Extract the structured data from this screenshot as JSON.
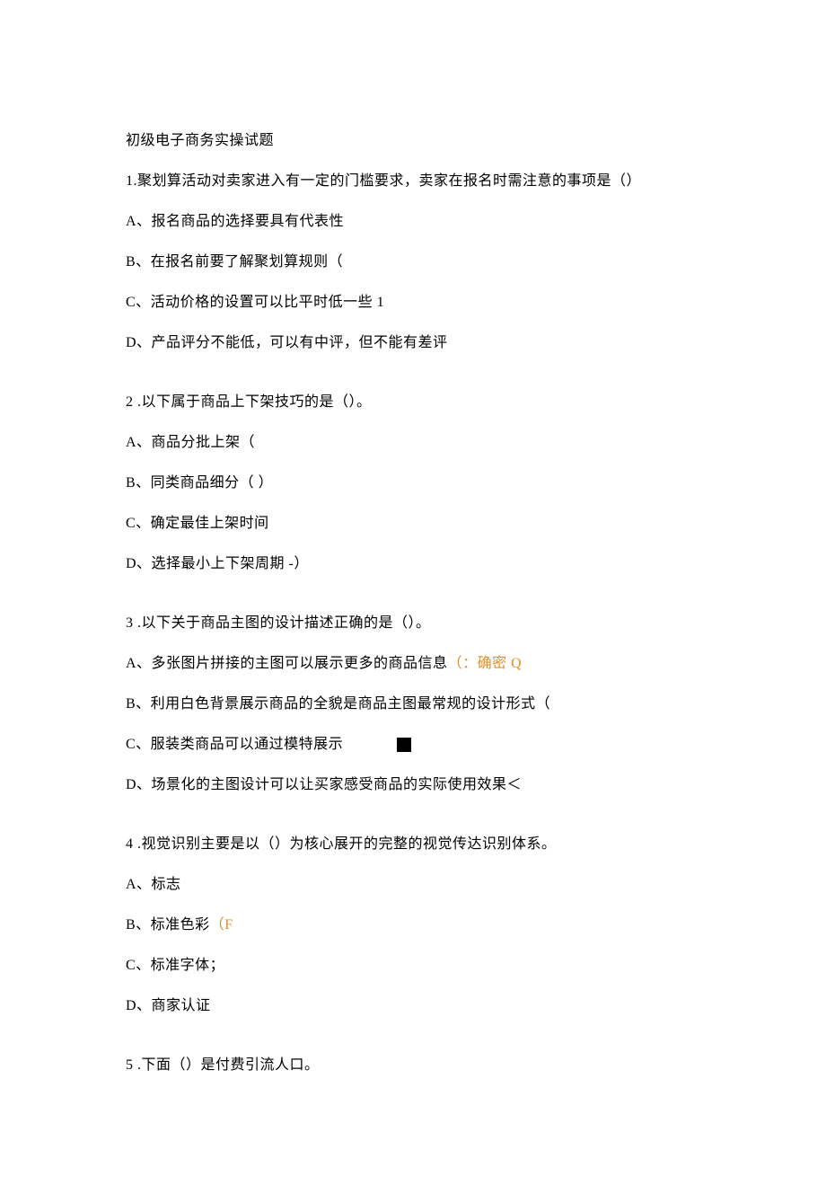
{
  "title": "初级电子商务实操试题",
  "q1": {
    "stem": "1.聚划算活动对卖家进入有一定的门槛要求，卖家在报名时需注意的事项是（）",
    "a": "A、报名商品的选择要具有代表性",
    "b": "B、在报名前要了解聚划算规则（",
    "c": "C、活动价格的设置可以比平时低一些 1",
    "d": "D、产品评分不能低，可以有中评，但不能有差评"
  },
  "q2": {
    "stem": "2  .以下属于商品上下架技巧的是（）。",
    "a": "A、商品分批上架（",
    "b": "B、同类商品细分（            ）",
    "c": "C、确定最佳上架时间",
    "d": "D、选择最小上下架周期             -）"
  },
  "q3": {
    "stem": "3  .以下关于商品主图的设计描述正确的是（）。",
    "a_pre": "A、多张图片拼接的主图可以展示更多的商品信息",
    "a_orange": "（：确密 Q",
    "b": "B、利用白色背景展示商品的全貌是商品主图最常规的设计形式（",
    "c": "C、服装类商品可以通过模特展示",
    "d": "D、场景化的主图设计可以让买家感受商品的实际使用效果＜"
  },
  "q4": {
    "stem": "4  .视觉识别主要是以（）为核心展开的完整的视觉传达识别体系。",
    "a": "A、标志",
    "b_pre": "B、标准色彩",
    "b_orange": "（F",
    "c": "C、标准字体；",
    "d": "D、商家认证"
  },
  "q5": {
    "stem": "5  .下面（）是付费引流人口。"
  }
}
